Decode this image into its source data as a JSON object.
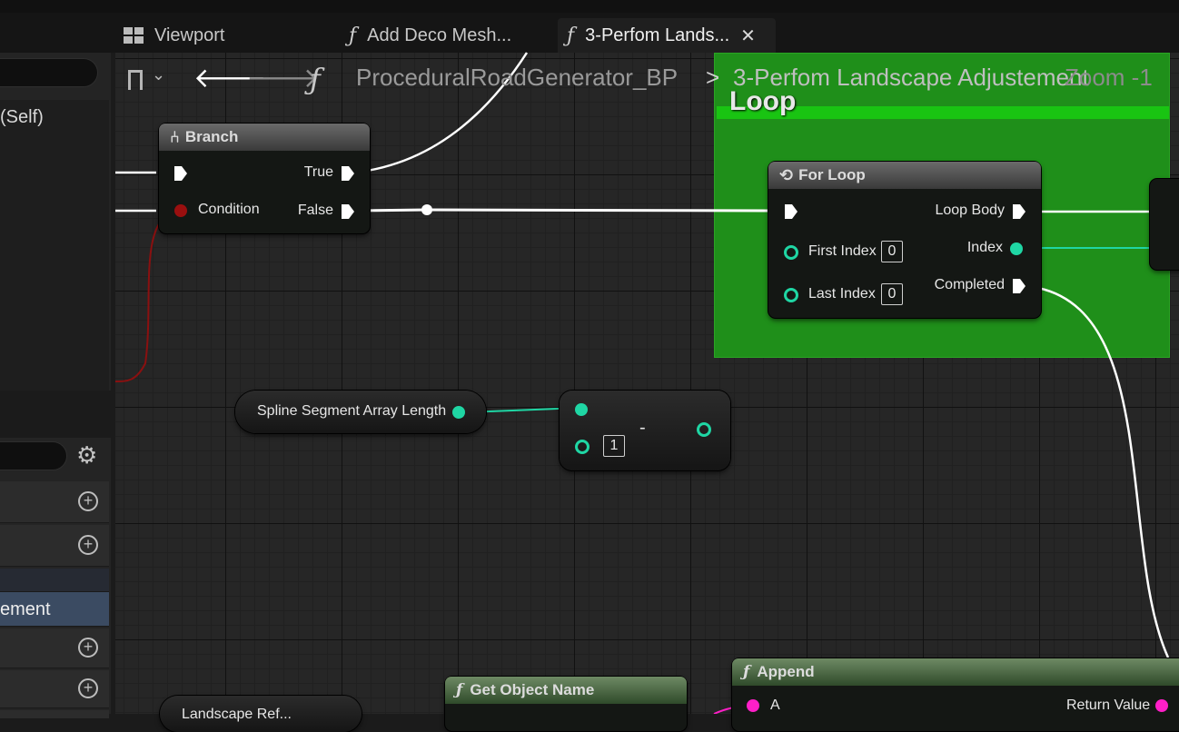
{
  "tabs": [
    {
      "label": "Viewport",
      "icon": "viewport-grid-icon"
    },
    {
      "label": "Add Deco Mesh...",
      "icon": "function-icon"
    },
    {
      "label": "3-Perfom Lands...",
      "icon": "function-icon",
      "active": true
    }
  ],
  "breadcrumb": {
    "blueprint": "ProceduralRoadGenerator_BP",
    "separator": ">",
    "function": "3-Perfom Landscape Adjustement",
    "zoom": "Zoom -1"
  },
  "left_panel": {
    "self_label": "(Self)",
    "selected_item": "ement"
  },
  "comment_box": {
    "title": "Loop",
    "color": "#1f8f1a"
  },
  "nodes": {
    "branch": {
      "title": "Branch",
      "true_label": "True",
      "false_label": "False",
      "condition_label": "Condition"
    },
    "for_loop": {
      "title": "For Loop",
      "first_index_label": "First Index",
      "first_index_value": "0",
      "last_index_label": "Last Index",
      "last_index_value": "0",
      "loop_body_label": "Loop Body",
      "index_label": "Index",
      "completed_label": "Completed"
    },
    "spline_len": {
      "title": "Spline Segment Array Length"
    },
    "subtract": {
      "operator": "-",
      "b_value": "1"
    },
    "append": {
      "title": "Append",
      "a_label": "A",
      "return_label": "Return Value"
    },
    "get_object_name": {
      "title": "Get Object Name"
    },
    "landscape_ref": {
      "title": "Landscape Ref..."
    }
  },
  "colors": {
    "exec": "#ffffff",
    "int_pin": "#1fd6a4",
    "string_pin": "#ff1fc8",
    "bool_pin": "#9a0f0f",
    "comment_green": "#1f8f1a"
  }
}
